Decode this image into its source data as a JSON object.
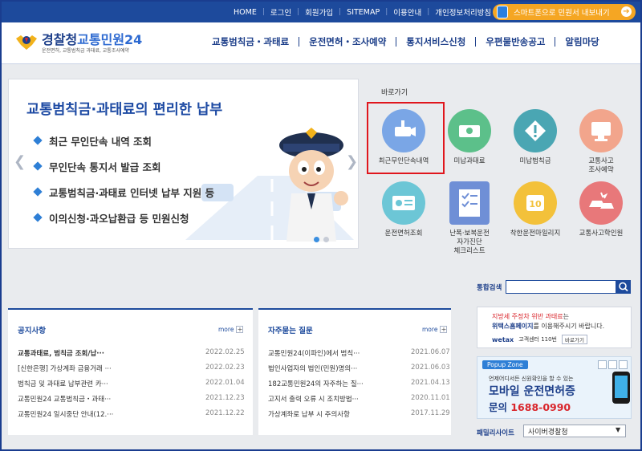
{
  "colors": {
    "primary": "#1d4a9c",
    "accent": "#f5a623",
    "highlight": "#e0161d"
  },
  "top_nav": {
    "items": [
      "HOME",
      "로그인",
      "회원가입",
      "SITEMAP",
      "이용안내",
      "개인정보처리방침"
    ],
    "smartphone_btn": "스마트폰으로 민원서 내보내기"
  },
  "logo": {
    "title_a": "경찰청",
    "title_b": "교통민원24",
    "subtitle": "운전면허, 교통범칙금 과태료, 교통조사예약"
  },
  "main_nav": [
    "교통범칙금・과태료",
    "운전면허・조사예약",
    "통지서비스신청",
    "우편물반송공고",
    "알림마당"
  ],
  "banner": {
    "title": "교통범칙금·과태료의 편리한 납부",
    "items": [
      "최근 무인단속 내역 조회",
      "무인단속 통지서 발급 조회",
      "교통범칙금·과태료 인터넷 납부 지원 등",
      "이의신청·과오납환급 등 민원신청"
    ]
  },
  "quick": {
    "title": "바로가기",
    "items": [
      {
        "label": "최근무인단속내역",
        "icon": "camera-icon",
        "color": "#7aa6e6"
      },
      {
        "label": "미납과태료",
        "icon": "money-icon",
        "color": "#5cc08a"
      },
      {
        "label": "미납범칙금",
        "icon": "warning-icon",
        "color": "#4aa6b3"
      },
      {
        "label": "교통사고\n조사예약",
        "icon": "computer-icon",
        "color": "#f2a58c"
      },
      {
        "label": "운전면허조회",
        "icon": "license-icon",
        "color": "#6cc6d6"
      },
      {
        "label": "난폭·보복운전\n자가진단\n체크리스트",
        "icon": "checklist-icon",
        "color": "#6f8fd6"
      },
      {
        "label": "착한운전마일리지",
        "icon": "mileage-icon",
        "color": "#f3c13a"
      },
      {
        "label": "교통사고학인원",
        "icon": "car-crash-icon",
        "color": "#e8787a"
      }
    ]
  },
  "notice": {
    "title": "공지사항",
    "more": "more",
    "rows": [
      {
        "title": "교통과태료, 범칙금 조회/납···",
        "date": "2022.02.25"
      },
      {
        "title": "[신한은행] 가상계좌 금융거래 ···",
        "date": "2022.02.23"
      },
      {
        "title": "범칙금 및 과태료 납부관련 카···",
        "date": "2022.01.04"
      },
      {
        "title": "교통민원24 교통범칙금・과태···",
        "date": "2021.12.23"
      },
      {
        "title": "교통민원24 일시중단 안내(12.···",
        "date": "2021.12.22"
      }
    ]
  },
  "faq": {
    "title": "자주묻는 질문",
    "more": "more",
    "rows": [
      {
        "title": "교통민원24(이파인)에서 범칙···",
        "date": "2021.06.07"
      },
      {
        "title": "법인사업자의 법인(민원)명의···",
        "date": "2021.06.03"
      },
      {
        "title": "182교통민원24의 자주하는 질···",
        "date": "2021.04.13"
      },
      {
        "title": "고지서 출력 오류 시 조치방법···",
        "date": "2020.11.01"
      },
      {
        "title": "가상계좌로 납부 시 주의사항",
        "date": "2017.11.29"
      }
    ]
  },
  "search": {
    "label": "통합검색",
    "placeholder": ""
  },
  "tax_banner": {
    "line1_red": "지방세 주정차 위반 과태료",
    "line1_rest": "는",
    "line2_bold": "위택스홈페이지",
    "line2_rest": "를 이용해주시기 바랍니다.",
    "brand": "wetax",
    "phone": "고객센터 110번",
    "go": "바로가기"
  },
  "popup_zone": {
    "title": "Popup Zone",
    "line1": "언제어디서든 신원확인을 할 수 있는",
    "line2": "모바일 운전면허증",
    "line3_pre": "문의 ",
    "line3_num": "1688-0990"
  },
  "family_site": {
    "label": "패밀리사이트",
    "selected": "사이버경찰청"
  }
}
